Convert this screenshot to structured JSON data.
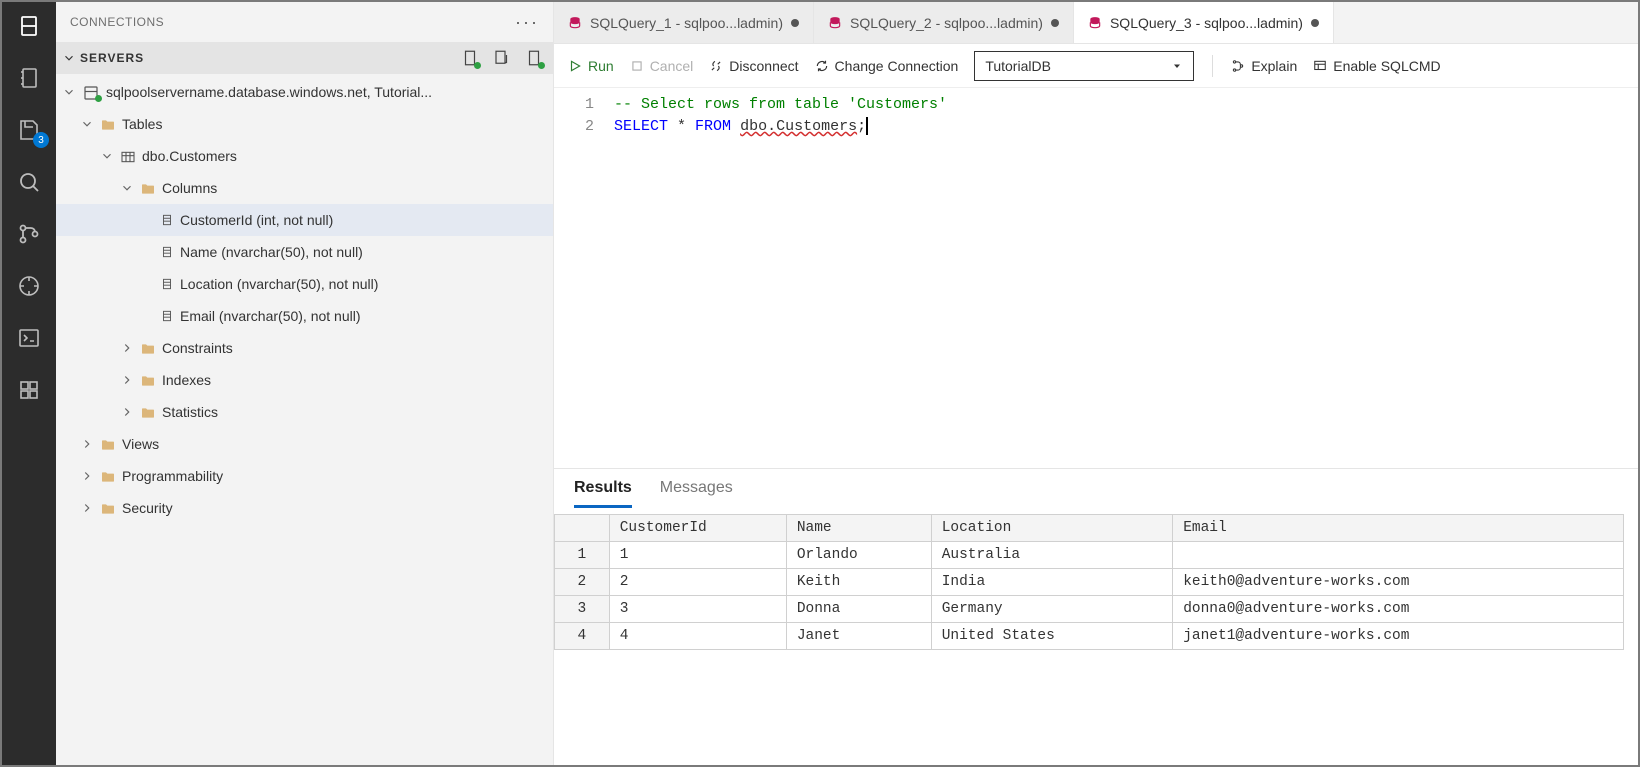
{
  "activityBar": {
    "badge": "3"
  },
  "sidePanel": {
    "title": "CONNECTIONS",
    "serversLabel": "SERVERS"
  },
  "tree": {
    "server": "sqlpoolservername.database.windows.net, Tutorial...",
    "tables": "Tables",
    "dboCustomers": "dbo.Customers",
    "columnsLabel": "Columns",
    "columns": [
      "CustomerId (int, not null)",
      "Name (nvarchar(50), not null)",
      "Location (nvarchar(50), not null)",
      "Email (nvarchar(50), not null)"
    ],
    "constraints": "Constraints",
    "indexes": "Indexes",
    "statistics": "Statistics",
    "views": "Views",
    "programmability": "Programmability",
    "security": "Security"
  },
  "tabs": [
    {
      "label": "SQLQuery_1 - sqlpoo...ladmin)"
    },
    {
      "label": "SQLQuery_2 - sqlpoo...ladmin)"
    },
    {
      "label": "SQLQuery_3 - sqlpoo...ladmin)"
    }
  ],
  "toolbar": {
    "run": "Run",
    "cancel": "Cancel",
    "disconnect": "Disconnect",
    "changeConn": "Change Connection",
    "dbSelected": "TutorialDB",
    "explain": "Explain",
    "enableSqlcmd": "Enable SQLCMD"
  },
  "editor": {
    "lines": {
      "l1": "1",
      "l2": "2"
    },
    "comment": "-- Select rows from table 'Customers'",
    "kw_select": "SELECT",
    "star": " * ",
    "kw_from": "FROM",
    "sp": " ",
    "tbl": "dbo.Customers",
    "semi": ";"
  },
  "results": {
    "resultsTab": "Results",
    "messagesTab": "Messages",
    "columns": {
      "c1": "CustomerId",
      "c2": "Name",
      "c3": "Location",
      "c4": "Email"
    },
    "rows": [
      {
        "n": "1",
        "id": "1",
        "name": "Orlando",
        "loc": "Australia",
        "email": ""
      },
      {
        "n": "2",
        "id": "2",
        "name": "Keith",
        "loc": "India",
        "email": "keith0@adventure-works.com"
      },
      {
        "n": "3",
        "id": "3",
        "name": "Donna",
        "loc": "Germany",
        "email": "donna0@adventure-works.com"
      },
      {
        "n": "4",
        "id": "4",
        "name": "Janet",
        "loc": "United States",
        "email": "janet1@adventure-works.com"
      }
    ]
  }
}
